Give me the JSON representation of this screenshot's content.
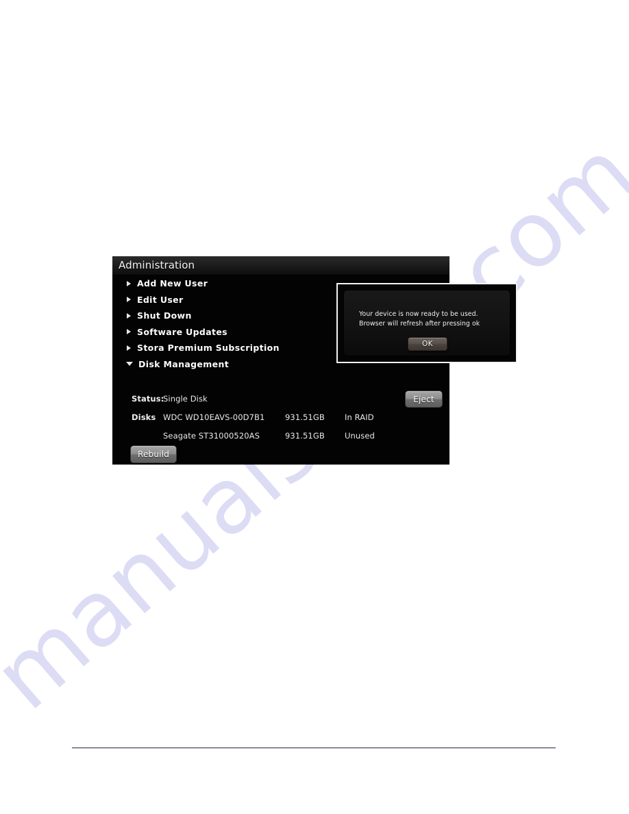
{
  "page": {
    "watermark_text": "manualshive.com",
    "watermark_color": "#c9c8f0",
    "background_color": "#ffffff",
    "footer_rule_color": "#2a2248"
  },
  "panel": {
    "title": "Administration",
    "background_color": "#030303",
    "menu": [
      {
        "label": "Add New User",
        "icon": "triangle-right-icon",
        "expanded": false
      },
      {
        "label": "Edit User",
        "icon": "triangle-right-icon",
        "expanded": false
      },
      {
        "label": "Shut Down",
        "icon": "triangle-right-icon",
        "expanded": false
      },
      {
        "label": "Software Updates",
        "icon": "triangle-right-icon",
        "expanded": false
      },
      {
        "label": "Stora Premium Subscription",
        "icon": "triangle-right-icon",
        "expanded": false
      },
      {
        "label": "Disk Management",
        "icon": "triangle-down-icon",
        "expanded": true
      }
    ],
    "disk_management": {
      "status_label": "Status:",
      "status_value": "Single Disk",
      "disks_label": "Disks",
      "disks": [
        {
          "name": "WDC WD10EAVS-00D7B1",
          "size": "931.51GB",
          "state": "In RAID",
          "action": "Eject"
        },
        {
          "name": "Seagate ST31000520AS",
          "size": "931.51GB",
          "state": "Unused",
          "action": ""
        }
      ],
      "rebuild_label": "Rebuild"
    }
  },
  "dialog": {
    "message": "Your device is now ready to be used.  Browser will refresh after pressing ok",
    "ok_label": "OK"
  }
}
